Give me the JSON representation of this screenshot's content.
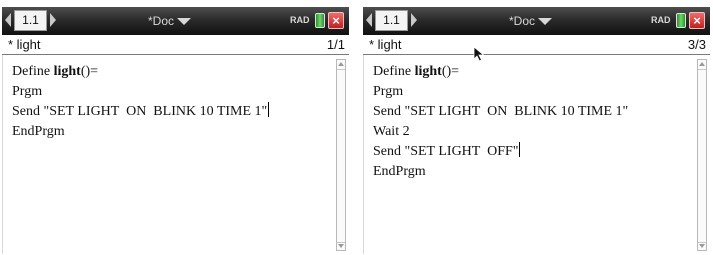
{
  "screens": [
    {
      "tab_label": "1.1",
      "doc_title": "*Doc",
      "angle_mode": "RAD",
      "program_name": "* light",
      "line_counter": "1/1",
      "code": {
        "define_prefix": "Define ",
        "define_name": "light",
        "define_suffix": "()=",
        "lines": [
          "Prgm",
          "Send \"SET LIGHT  ON  BLINK 10 TIME 1\"",
          "EndPrgm"
        ]
      }
    },
    {
      "tab_label": "1.1",
      "doc_title": "*Doc",
      "angle_mode": "RAD",
      "program_name": "* light",
      "line_counter": "3/3",
      "code": {
        "define_prefix": "Define ",
        "define_name": "light",
        "define_suffix": "()=",
        "lines": [
          "Prgm",
          "Send \"SET LIGHT  ON  BLINK 10 TIME 1\"",
          "Wait 2",
          "Send \"SET LIGHT  OFF\"",
          "EndPrgm"
        ]
      }
    }
  ],
  "icons": {
    "close": "×",
    "battery": "battery-icon",
    "pointer": "mouse-pointer-icon"
  },
  "colors": {
    "titlebar": "#2b2b2b",
    "close": "#c12020",
    "battery": "#2f8d2f"
  }
}
